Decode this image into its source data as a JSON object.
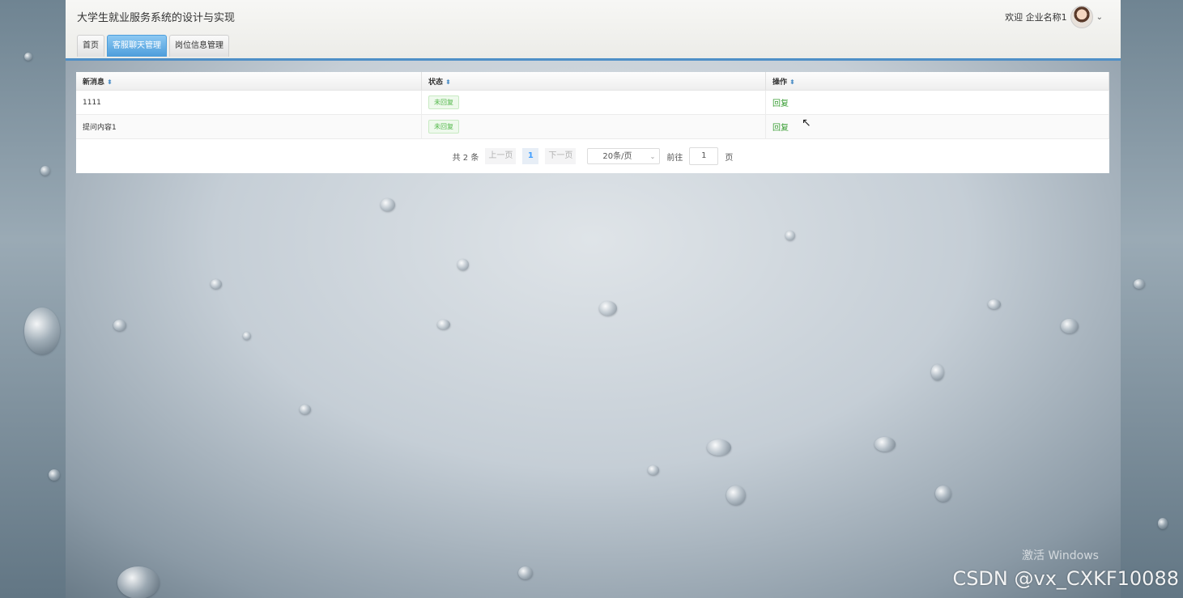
{
  "header": {
    "title": "大学生就业服务系统的设计与实现",
    "welcome": "欢迎 企业名称1"
  },
  "tabs": [
    {
      "label": "首页",
      "active": false
    },
    {
      "label": "客服聊天管理",
      "active": true
    },
    {
      "label": "岗位信息管理",
      "active": false
    }
  ],
  "table": {
    "columns": [
      "新消息",
      "状态",
      "操作"
    ],
    "rows": [
      {
        "message": "1111",
        "status": "未回复",
        "action": "回复"
      },
      {
        "message": "提问内容1",
        "status": "未回复",
        "action": "回复"
      }
    ]
  },
  "pagination": {
    "total": "共 2 条",
    "prev": "上一页",
    "current": "1",
    "next": "下一页",
    "page_size": "20条/页",
    "goto_label": "前往",
    "goto_value": "1",
    "page_unit": "页"
  },
  "overlay": {
    "windows_activation": "激活 Windows",
    "watermark": "CSDN @vx_CXKF10088"
  },
  "colors": {
    "accent": "#4e8fc7",
    "active_tab": "#4c9ddb",
    "status_green": "#52b84a"
  }
}
